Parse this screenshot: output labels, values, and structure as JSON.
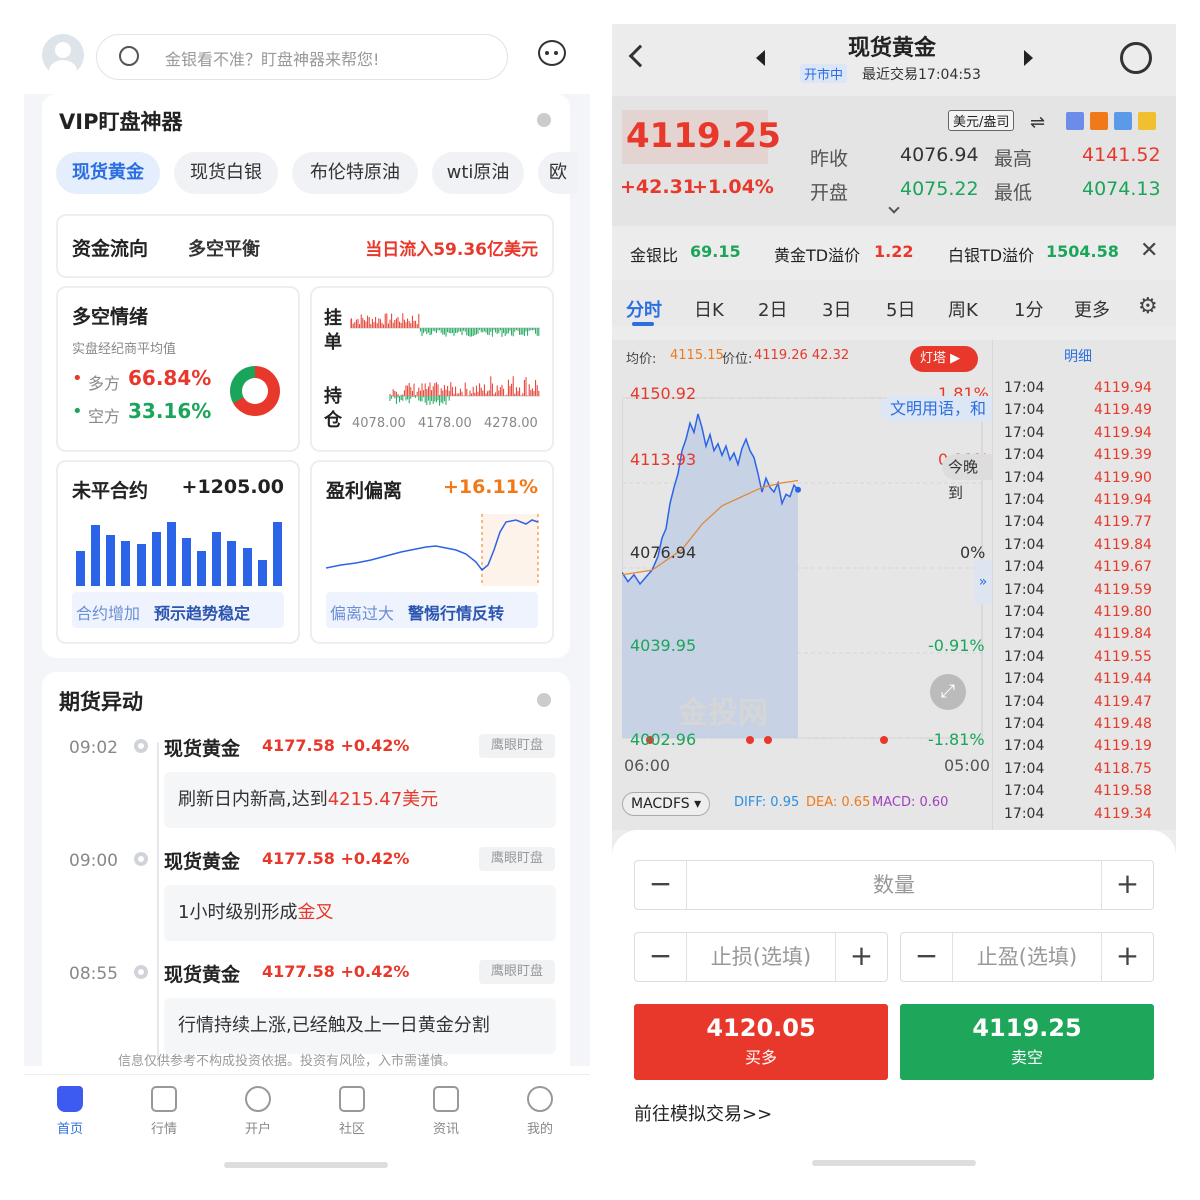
{
  "left": {
    "search_placeholder": "金银看不准？盯盘神器来帮您!",
    "vip_title": "VIP盯盘神器",
    "tabs": [
      "现货黄金",
      "现货白银",
      "布伦特原油",
      "wti原油",
      "欧"
    ],
    "flow": {
      "label": "资金流向",
      "state": "多空平衡",
      "inflow": "当日流入59.36亿美元"
    },
    "sentiment": {
      "title": "多空情绪",
      "subtitle": "实盘经纪商平均值",
      "long_label": "多方",
      "long_value": "66.84%",
      "short_label": "空方",
      "short_value": "33.16%",
      "long_share": 0.6684
    },
    "order": {
      "label1": "挂",
      "label2": "单",
      "label3": "持",
      "label4": "仓",
      "ticks": [
        "4078.00",
        "4178.00",
        "4278.00"
      ]
    },
    "open_interest": {
      "title": "未平合约",
      "value": "+1205.00",
      "note1": "合约增加",
      "note2": "预示趋势稳定",
      "bars": [
        0.55,
        0.95,
        0.8,
        0.7,
        0.65,
        0.85,
        1.0,
        0.75,
        0.55,
        0.85,
        0.7,
        0.6,
        0.4,
        1.0
      ]
    },
    "pl_deviation": {
      "title": "盈利偏离",
      "value": "+16.11%",
      "note1": "偏离过大",
      "note2": "警惕行情反转"
    },
    "futures_title": "期货异动",
    "events": [
      {
        "time": "09:02",
        "name": "现货黄金",
        "change": "4177.58 +0.42%",
        "tag": "鹰眼盯盘",
        "text": "刷新日内新高,达到",
        "highlight": "4215.47美元"
      },
      {
        "time": "09:00",
        "name": "现货黄金",
        "change": "4177.58 +0.42%",
        "tag": "鹰眼盯盘",
        "text": "1小时级别形成",
        "highlight": "金叉"
      },
      {
        "time": "08:55",
        "name": "现货黄金",
        "change": "4177.58 +0.42%",
        "tag": "鹰眼盯盘",
        "text": "行情持续上涨,已经触及上一日黄金分割",
        "highlight": ""
      }
    ],
    "disclaimer": "信息仅供参考不构成投资依据。投资有风险，入市需谨慎。",
    "nav": [
      "首页",
      "行情",
      "开户",
      "社区",
      "资讯",
      "我的"
    ]
  },
  "right": {
    "title": "现货黄金",
    "market_status": "开市中",
    "last_trade": "最近交易17:04:53",
    "price": "4119.25",
    "change": "+42.31",
    "change_pct": "+1.04%",
    "unit": "美元/盎司",
    "prev_close_label": "昨收",
    "prev_close": "4076.94",
    "high_label": "最高",
    "high": "4141.52",
    "open_label": "开盘",
    "open": "4075.22",
    "low_label": "最低",
    "low": "4074.13",
    "ratio_label": "金银比",
    "ratio": "69.15",
    "td_gold_label": "黄金TD溢价",
    "td_gold": "1.22",
    "td_silver_label": "白银TD溢价",
    "td_silver": "1504.58",
    "tabs": [
      "分时",
      "日K",
      "2日",
      "3日",
      "5日",
      "周K",
      "1分",
      "更多"
    ],
    "avg_label": "均价:",
    "avg": "4115.15",
    "pos_label": "价位:",
    "pos": "4119.26 42.32",
    "lighthouse": "灯塔",
    "detail_label": "明细",
    "chart_y": [
      "4150.92",
      "4113.93",
      "4076.94",
      "4039.95",
      "4002.96"
    ],
    "chart_pct": [
      "1.81%",
      "0.91%",
      "0%",
      "-0.91%",
      "-1.81%"
    ],
    "time_start": "06:00",
    "time_end": "05:00",
    "overlay1": "文明用语，和",
    "overlay2": "今晚到",
    "watermark": "金投网",
    "indicator": "MACDFS",
    "diff": "DIFF: 0.95",
    "dea": "DEA: 0.65",
    "macd": "MACD: 0.60",
    "ticks": [
      [
        "17:04",
        "4119.94",
        "red"
      ],
      [
        "17:04",
        "4119.49",
        "red"
      ],
      [
        "17:04",
        "4119.94",
        "red"
      ],
      [
        "17:04",
        "4119.39",
        "red"
      ],
      [
        "17:04",
        "4119.90",
        "red"
      ],
      [
        "17:04",
        "4119.94",
        "red"
      ],
      [
        "17:04",
        "4119.77",
        "red"
      ],
      [
        "17:04",
        "4119.84",
        "red"
      ],
      [
        "17:04",
        "4119.67",
        "red"
      ],
      [
        "17:04",
        "4119.59",
        "red"
      ],
      [
        "17:04",
        "4119.80",
        "red"
      ],
      [
        "17:04",
        "4119.84",
        "red"
      ],
      [
        "17:04",
        "4119.55",
        "red"
      ],
      [
        "17:04",
        "4119.44",
        "red"
      ],
      [
        "17:04",
        "4119.47",
        "red"
      ],
      [
        "17:04",
        "4119.48",
        "red"
      ],
      [
        "17:04",
        "4119.19",
        "red"
      ],
      [
        "17:04",
        "4118.75",
        "red"
      ],
      [
        "17:04",
        "4119.58",
        "red"
      ],
      [
        "17:04",
        "4119.34",
        "red"
      ]
    ],
    "qty_placeholder": "数量",
    "sl_placeholder": "止损(选填)",
    "tp_placeholder": "止盈(选填)",
    "buy_price": "4120.05",
    "buy_label": "买多",
    "sell_price": "4119.25",
    "sell_label": "卖空",
    "sim_link": "前往模拟交易>>"
  }
}
